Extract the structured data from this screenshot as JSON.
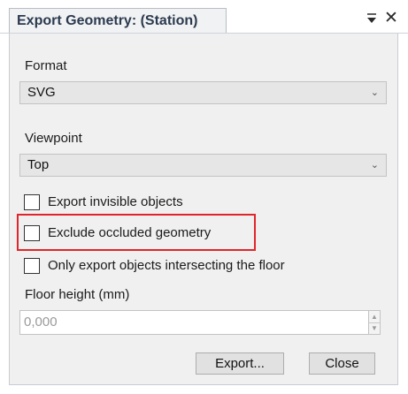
{
  "tab": {
    "title": "Export Geometry: (Station)"
  },
  "format": {
    "label": "Format",
    "value": "SVG"
  },
  "viewpoint": {
    "label": "Viewpoint",
    "value": "Top"
  },
  "options": [
    {
      "label": "Export invisible objects",
      "checked": false
    },
    {
      "label": "Exclude occluded geometry",
      "checked": false
    },
    {
      "label": "Only export objects intersecting the floor",
      "checked": false
    }
  ],
  "floor_height": {
    "label": "Floor height (mm)",
    "value": "0,000"
  },
  "buttons": {
    "export": "Export...",
    "close": "Close"
  },
  "icons": {
    "pin": "pin-icon",
    "close": "close-icon",
    "dropdown": "chevron-down-icon"
  },
  "colors": {
    "highlight": "#e0262b",
    "tab_text": "#2b3a4e",
    "panel_bg": "#f0f0f0"
  }
}
